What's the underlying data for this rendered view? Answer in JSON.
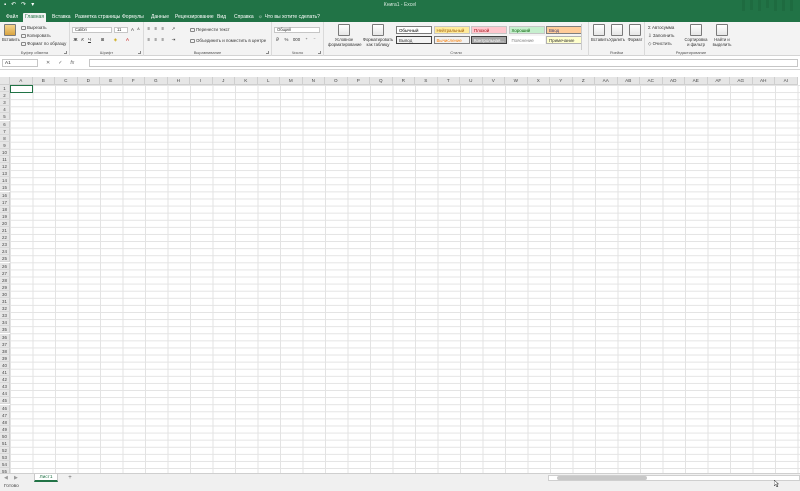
{
  "window": {
    "title": "Книга1 - Excel"
  },
  "tabs": [
    "Файл",
    "Главная",
    "Вставка",
    "Разметка страницы",
    "Формулы",
    "Данные",
    "Рецензирование",
    "Вид",
    "Справка"
  ],
  "tell_me": "Что вы хотите сделать?",
  "clipboard": {
    "paste": "Вставить",
    "cut": "Вырезать",
    "copy": "Копировать",
    "painter": "Формат по образцу",
    "label": "Буфер обмена"
  },
  "font": {
    "name": "Calibri",
    "size": "11",
    "label": "Шрифт"
  },
  "alignment": {
    "wrap": "Перенести текст",
    "merge": "Объединить и поместить в центре",
    "label": "Выравнивание"
  },
  "number": {
    "format": "Общий",
    "label": "Число"
  },
  "styles": {
    "conditional": "Условное форматирование",
    "as_table": "Форматировать как таблицу",
    "items": [
      {
        "label": "Обычный",
        "bg": "#ffffff",
        "color": "#000000",
        "border": "#7a7a7a"
      },
      {
        "label": "Нейтральный",
        "bg": "#ffeb9c",
        "color": "#9c5700",
        "border": "#c6c6c6"
      },
      {
        "label": "Плохой",
        "bg": "#ffc7ce",
        "color": "#9c0006",
        "border": "#c6c6c6"
      },
      {
        "label": "Хороший",
        "bg": "#c6efce",
        "color": "#006100",
        "border": "#c6c6c6"
      },
      {
        "label": "Ввод",
        "bg": "#ffcc99",
        "color": "#3f3f76",
        "border": "#7f7f7f"
      },
      {
        "label": "Вывод",
        "bg": "#f2f2f2",
        "color": "#3f3f3f",
        "border": "#3f3f3f"
      },
      {
        "label": "Вычисление",
        "bg": "#f2f2f2",
        "color": "#fa7d00",
        "border": "#7f7f7f"
      },
      {
        "label": "Контрольная...",
        "bg": "#a5a5a5",
        "color": "#ffffff",
        "border": "#3f3f3f"
      },
      {
        "label": "Пояснение",
        "bg": "#ffffff",
        "color": "#7f7f7f",
        "border": "#ffffff"
      },
      {
        "label": "Примечание",
        "bg": "#ffffcc",
        "color": "#333333",
        "border": "#b2b2b2"
      }
    ],
    "label": "Стили"
  },
  "cells_group": {
    "insert": "Вставить",
    "delete": "Удалить",
    "format": "Формат",
    "label": "Ячейки"
  },
  "editing": {
    "autosum": "Автосумма",
    "fill": "Заполнить",
    "clear": "Очистить",
    "sort": "Сортировка и фильтр",
    "find": "Найти и выделить",
    "label": "Редактирование"
  },
  "formula_bar": {
    "name_box": "A1",
    "fx": "fx"
  },
  "columns": [
    "A",
    "B",
    "C",
    "D",
    "E",
    "F",
    "G",
    "H",
    "I",
    "J",
    "K",
    "L",
    "M",
    "N",
    "O",
    "P",
    "Q",
    "R",
    "S",
    "T",
    "U",
    "V",
    "W",
    "X",
    "Y",
    "Z",
    "AA",
    "AB",
    "AC",
    "AD",
    "AE",
    "AF",
    "AG",
    "AH",
    "AI"
  ],
  "rows": [
    "1",
    "2",
    "3",
    "4",
    "5",
    "6",
    "7",
    "8",
    "9",
    "10",
    "11",
    "12",
    "13",
    "14",
    "15",
    "16",
    "17",
    "18",
    "19",
    "20",
    "21",
    "22",
    "23",
    "24",
    "25",
    "26",
    "27",
    "28",
    "29",
    "30",
    "31",
    "32",
    "33",
    "34",
    "35",
    "36",
    "37",
    "38",
    "39",
    "40",
    "41",
    "42",
    "43",
    "44",
    "45",
    "46",
    "47",
    "48",
    "49",
    "50",
    "51",
    "52",
    "53",
    "54",
    "55"
  ],
  "sheet": {
    "name": "Лист1",
    "add": "+"
  },
  "status": "Готово",
  "colors": {
    "accent": "#217346"
  }
}
